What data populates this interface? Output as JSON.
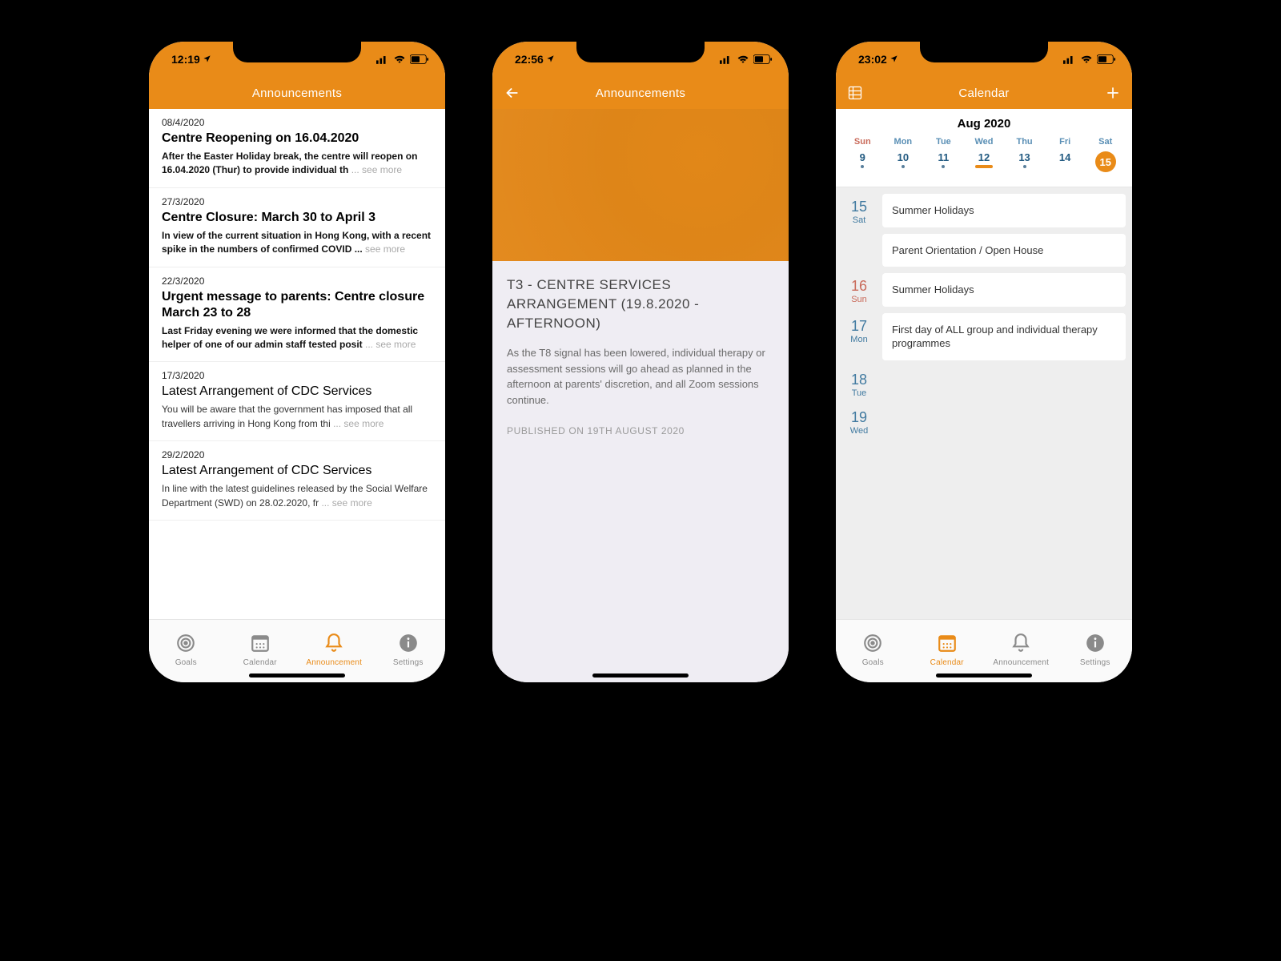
{
  "phone1": {
    "statusTime": "12:19",
    "navTitle": "Announcements",
    "tabs": {
      "goals": "Goals",
      "calendar": "Calendar",
      "announcement": "Announcement",
      "settings": "Settings",
      "active": "announcement"
    },
    "announcements": [
      {
        "date": "08/4/2020",
        "title": "Centre Reopening on 16.04.2020",
        "bold": true,
        "body": "After the Easter Holiday break, the centre will reopen on 16.04.2020 (Thur) to provide individual th",
        "more": "... see more"
      },
      {
        "date": "27/3/2020",
        "title": "Centre Closure: March 30 to April 3",
        "bold": true,
        "body": "In view of the current situation in Hong Kong, with a recent spike in the numbers of confirmed COVID ...",
        "more": "see more"
      },
      {
        "date": "22/3/2020",
        "title": "Urgent message to parents: Centre closure March 23 to 28",
        "bold": true,
        "body": "Last Friday evening we were informed that the domestic helper of one of our admin staff tested posit",
        "more": "... see more"
      },
      {
        "date": "17/3/2020",
        "title": "Latest Arrangement of CDC Services",
        "bold": false,
        "body": "You will be aware that the government has imposed that all travellers arriving in Hong Kong from thi",
        "more": "... see more"
      },
      {
        "date": "29/2/2020",
        "title": "Latest Arrangement of CDC Services",
        "bold": false,
        "body": "In line with the latest guidelines released by the Social Welfare Department (SWD) on 28.02.2020, fr",
        "more": "... see more"
      }
    ]
  },
  "phone2": {
    "statusTime": "22:56",
    "navTitle": "Announcements",
    "detail": {
      "title": "T3 - CENTRE SERVICES ARRANGEMENT (19.8.2020 - AFTERNOON)",
      "body": "As the T8 signal has been lowered, individual therapy or assessment sessions will go ahead as planned in the afternoon at parents' discretion, and all Zoom sessions continue.",
      "published": "PUBLISHED ON 19TH AUGUST 2020"
    }
  },
  "phone3": {
    "statusTime": "23:02",
    "navTitle": "Calendar",
    "month": "Aug 2020",
    "dow": [
      "Sun",
      "Mon",
      "Tue",
      "Wed",
      "Thu",
      "Fri",
      "Sat"
    ],
    "days": [
      {
        "n": "9",
        "dot": true
      },
      {
        "n": "10",
        "dot": true
      },
      {
        "n": "11",
        "dot": true
      },
      {
        "n": "12",
        "dot": false,
        "bar": true
      },
      {
        "n": "13",
        "dot": true
      },
      {
        "n": "14",
        "dot": false
      },
      {
        "n": "15",
        "dot": false,
        "sel": true
      }
    ],
    "agenda": [
      {
        "day": "15",
        "dow": "Sat",
        "events": [
          "Summer Holidays",
          "Parent Orientation / Open House"
        ]
      },
      {
        "day": "16",
        "dow": "Sun",
        "sun": true,
        "events": [
          "Summer Holidays"
        ]
      },
      {
        "day": "17",
        "dow": "Mon",
        "events": [
          "First day of ALL group and individual therapy programmes"
        ]
      },
      {
        "day": "18",
        "dow": "Tue",
        "events": []
      },
      {
        "day": "19",
        "dow": "Wed",
        "events": []
      }
    ],
    "tabs": {
      "goals": "Goals",
      "calendar": "Calendar",
      "announcement": "Announcement",
      "settings": "Settings",
      "active": "calendar"
    }
  }
}
